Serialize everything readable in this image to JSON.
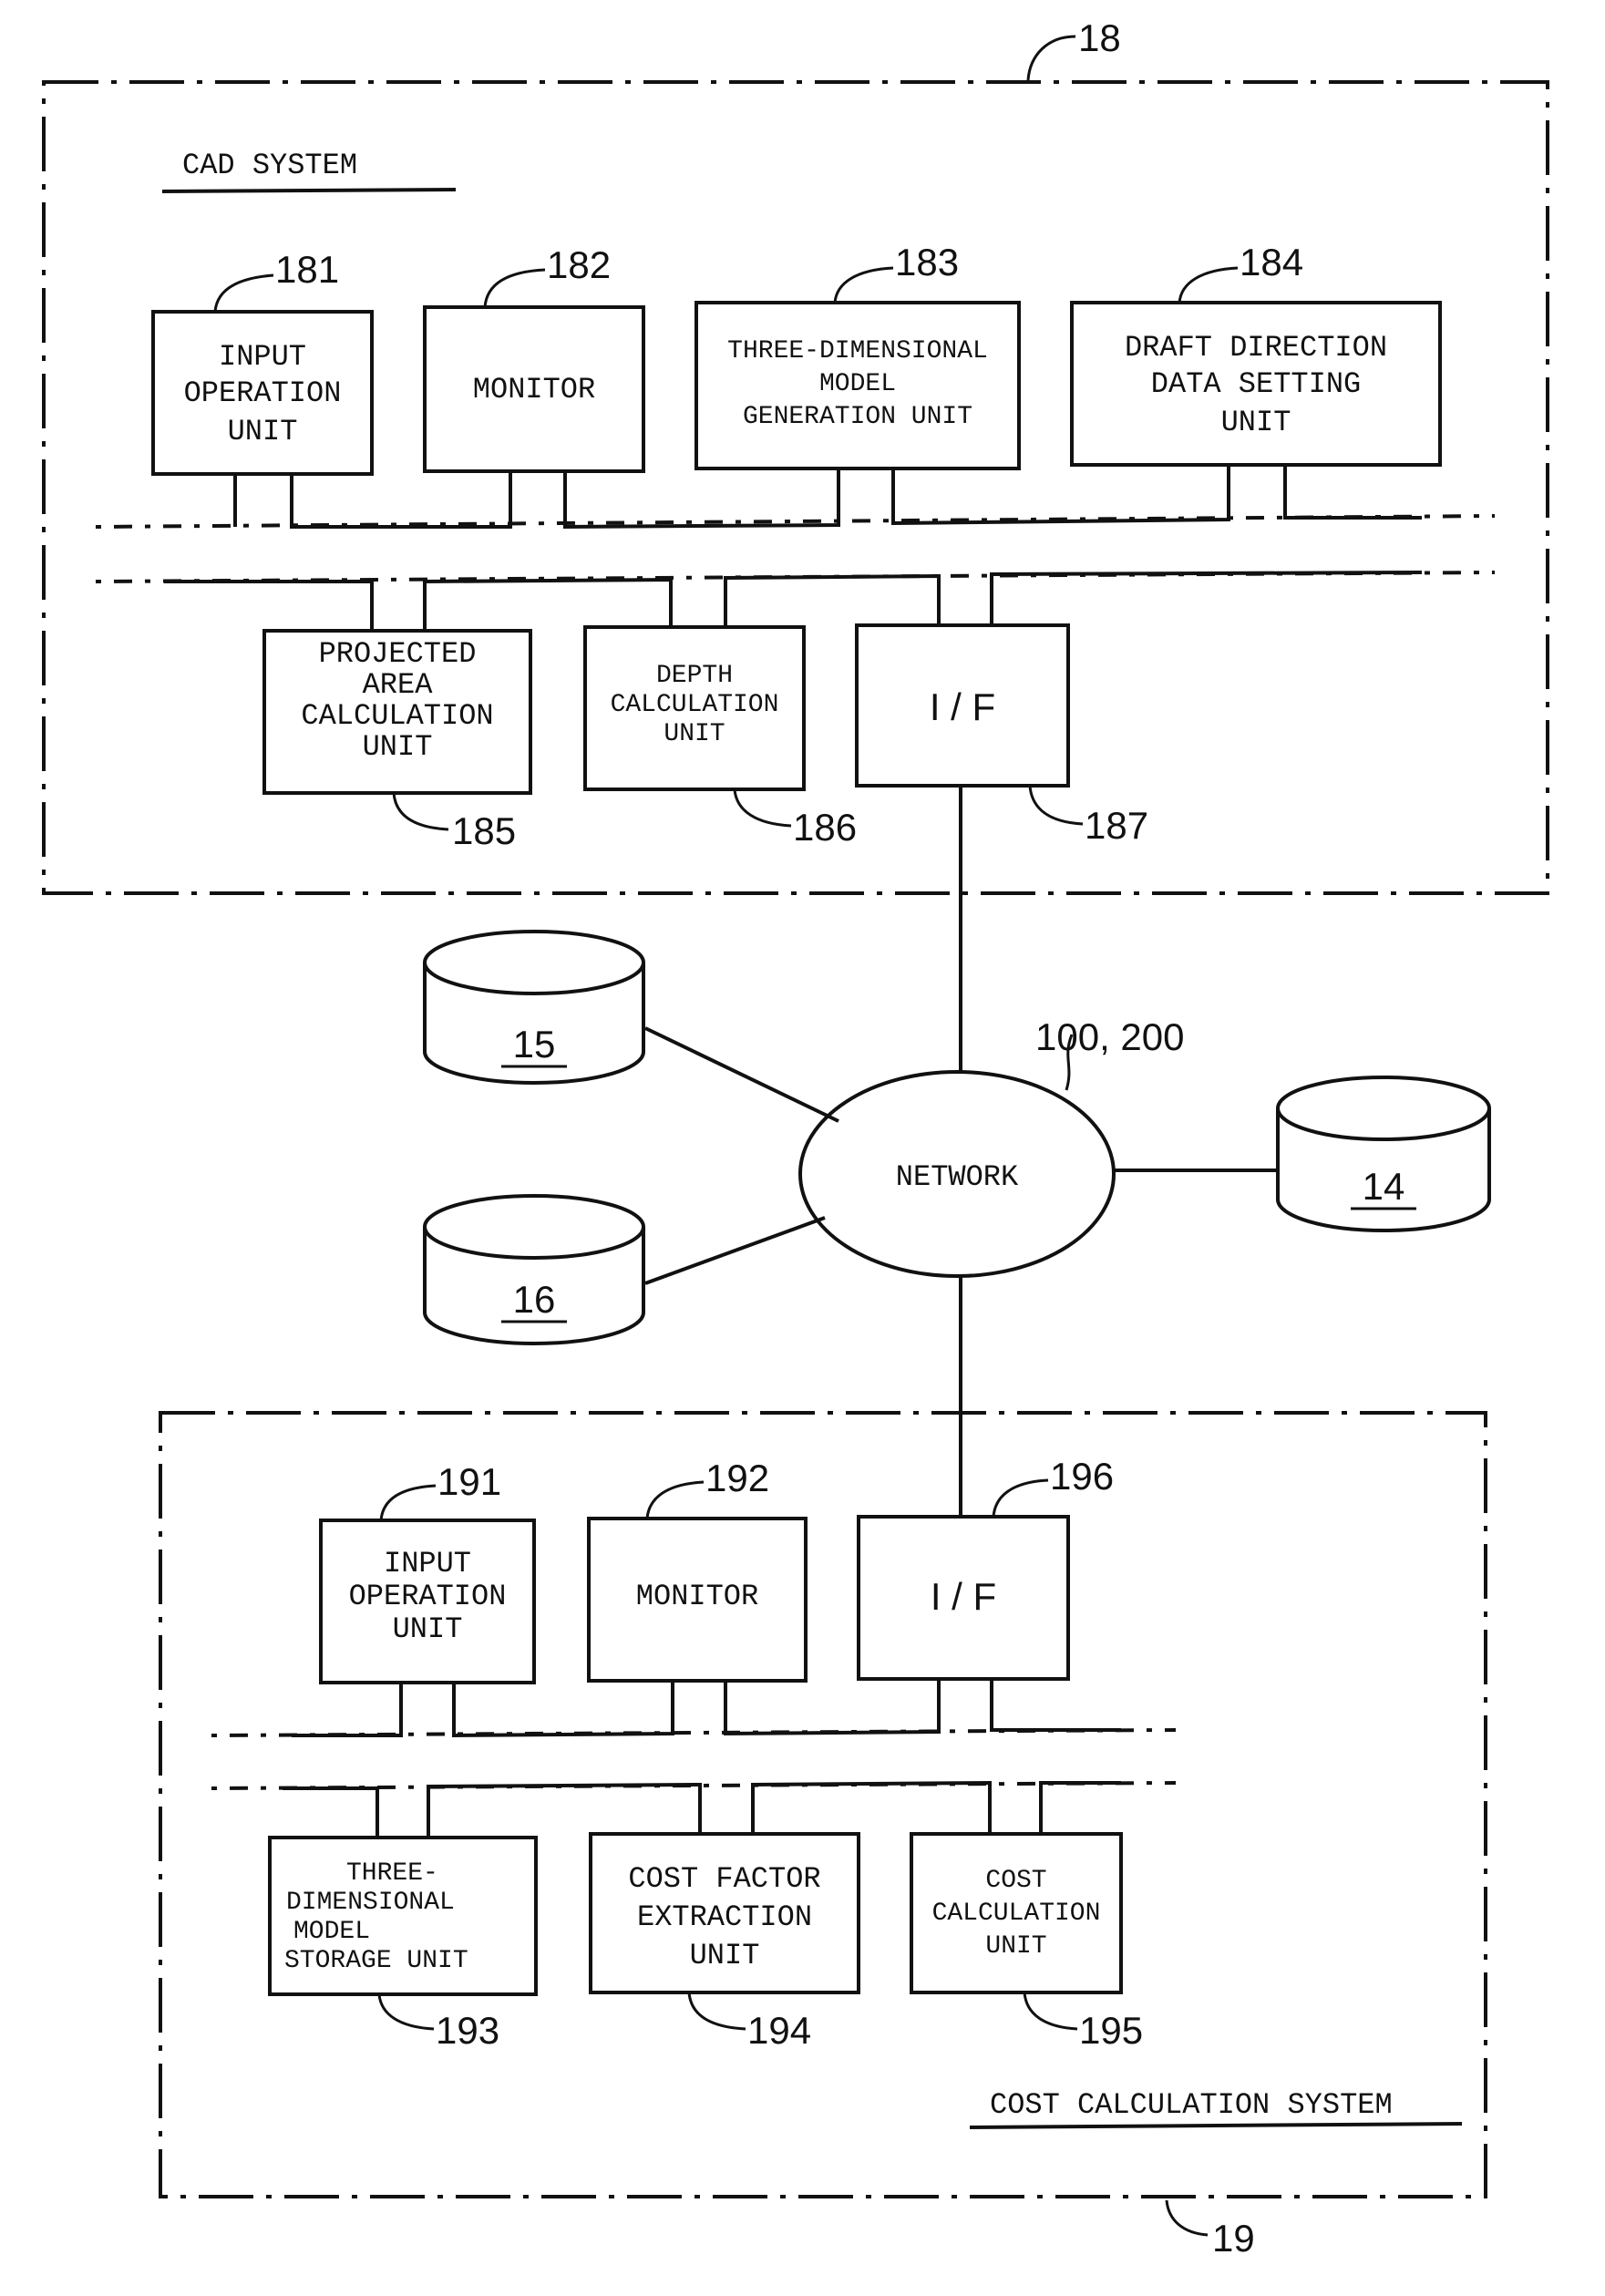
{
  "cad_system": {
    "title": "CAD SYSTEM",
    "ref": "18",
    "units": [
      {
        "ref": "181",
        "lines": [
          "INPUT",
          "OPERATION",
          "UNIT"
        ]
      },
      {
        "ref": "182",
        "lines": [
          "MONITOR"
        ]
      },
      {
        "ref": "183",
        "lines": [
          "THREE-DIMENSIONAL",
          "MODEL",
          "GENERATION UNIT"
        ]
      },
      {
        "ref": "184",
        "lines": [
          "DRAFT DIRECTION",
          "DATA SETTING",
          "UNIT"
        ]
      },
      {
        "ref": "185",
        "lines": [
          "PROJECTED",
          "AREA",
          "CALCULATION",
          "UNIT"
        ]
      },
      {
        "ref": "186",
        "lines": [
          "DEPTH",
          "CALCULATION",
          "UNIT"
        ]
      },
      {
        "ref": "187",
        "lines": [
          "I / F"
        ]
      }
    ]
  },
  "network": {
    "label": "NETWORK",
    "ref": "100, 200",
    "databases": [
      {
        "ref": "15"
      },
      {
        "ref": "16"
      },
      {
        "ref": "14"
      }
    ]
  },
  "cost_system": {
    "title": "COST CALCULATION SYSTEM",
    "ref": "19",
    "units": [
      {
        "ref": "191",
        "lines": [
          "INPUT",
          "OPERATION",
          "UNIT"
        ]
      },
      {
        "ref": "192",
        "lines": [
          "MONITOR"
        ]
      },
      {
        "ref": "196",
        "lines": [
          "I / F"
        ]
      },
      {
        "ref": "193",
        "lines": [
          "THREE-",
          "DIMENSIONAL",
          "MODEL",
          "STORAGE UNIT"
        ]
      },
      {
        "ref": "194",
        "lines": [
          "COST FACTOR",
          "EXTRACTION",
          "UNIT"
        ]
      },
      {
        "ref": "195",
        "lines": [
          "COST",
          "CALCULATION",
          "UNIT"
        ]
      }
    ]
  }
}
